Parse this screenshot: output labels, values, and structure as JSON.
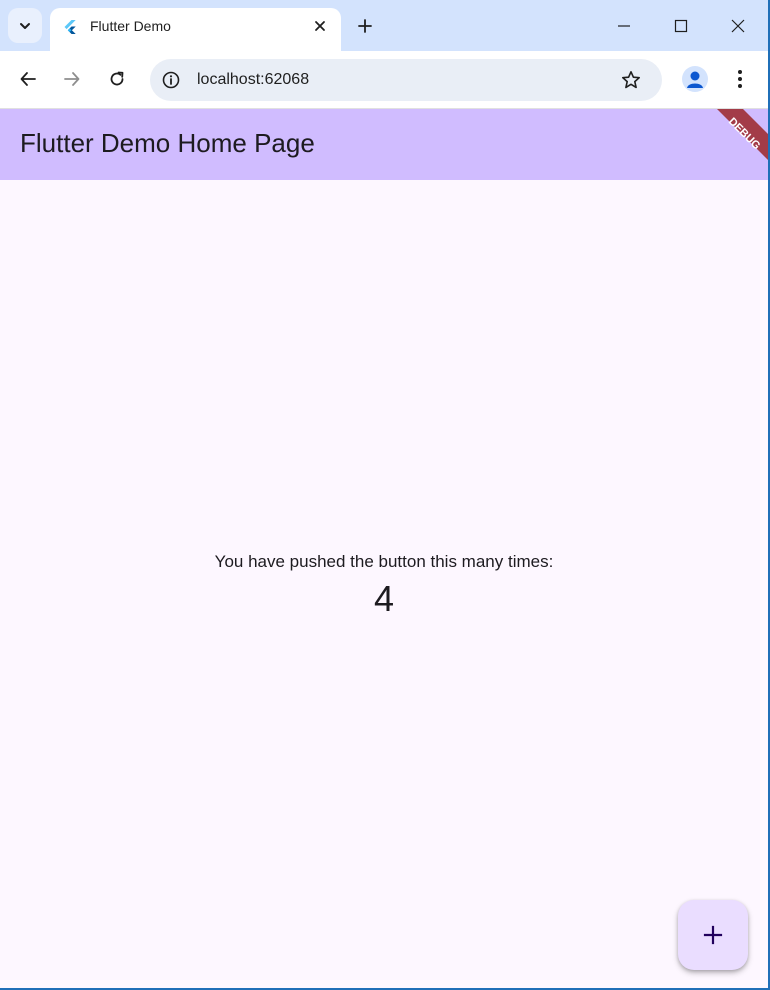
{
  "browser": {
    "tab": {
      "title": "Flutter Demo"
    },
    "address_bar": {
      "url": "localhost:62068"
    }
  },
  "app": {
    "appbar_title": "Flutter Demo Home Page",
    "debug_banner_label": "DEBUG",
    "counter_label": "You have pushed the button this many times:",
    "counter_value": "4",
    "fab_icon": "plus-icon"
  },
  "colors": {
    "tabstrip_bg": "#d3e3fd",
    "appbar_bg": "#d0bcff",
    "page_bg": "#fdf7ff",
    "fab_bg": "#eaddff",
    "debug_banner": "#a33c48"
  }
}
